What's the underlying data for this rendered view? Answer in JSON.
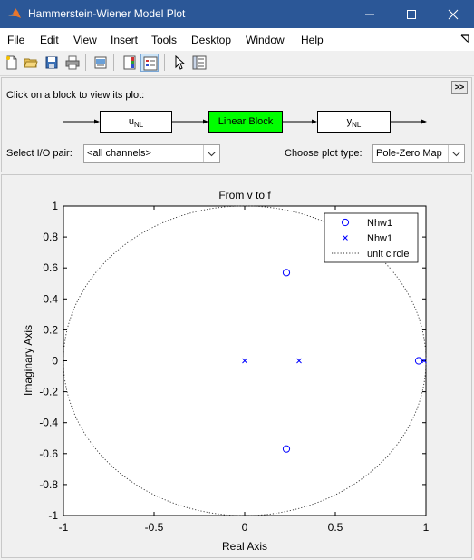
{
  "window": {
    "title": "Hammerstein-Wiener Model Plot"
  },
  "menu": [
    "File",
    "Edit",
    "View",
    "Insert",
    "Tools",
    "Desktop",
    "Window",
    "Help"
  ],
  "toolbar": {
    "icons": [
      "new-file-icon",
      "open-folder-icon",
      "save-icon",
      "print-icon",
      "print-preview-icon",
      "colorbar-icon",
      "legend-icon",
      "pointer-icon",
      "property-inspector-icon"
    ]
  },
  "panel": {
    "instruction": "Click on a block to view its plot:",
    "expand_label": ">>",
    "blocks": {
      "input": {
        "main": "u",
        "sub": "NL"
      },
      "linear": "Linear Block",
      "output": {
        "main": "y",
        "sub": "NL"
      }
    },
    "io_label": "Select I/O pair:",
    "io_value": "<all channels>",
    "plot_type_label": "Choose plot type:",
    "plot_type_value": "Pole-Zero Map"
  },
  "colors": {
    "titlebar": "#2b5797",
    "linear_block": "#00ff00",
    "marker": "#0000ff"
  },
  "chart_data": {
    "type": "scatter",
    "title": "From v to f",
    "xlabel": "Real Axis",
    "ylabel": "Imaginary Axis",
    "xlim": [
      -1,
      1
    ],
    "ylim": [
      -1,
      1
    ],
    "x_ticks": [
      "-1",
      "-0.5",
      "0",
      "0.5",
      "1"
    ],
    "y_ticks": [
      "1",
      "0.8",
      "0.6",
      "0.4",
      "0.2",
      "0",
      "-0.2",
      "-0.4",
      "-0.6",
      "-0.8",
      "-1"
    ],
    "grid": false,
    "legend_position": "top-right",
    "series": [
      {
        "name": "Nhw1",
        "marker": "o",
        "color": "#0000ff",
        "points": [
          [
            0.23,
            0.57
          ],
          [
            0.23,
            -0.57
          ],
          [
            0.96,
            0.0
          ]
        ]
      },
      {
        "name": "Nhw1",
        "marker": "x",
        "color": "#0000ff",
        "points": [
          [
            0.0,
            0.0
          ],
          [
            0.3,
            0.0
          ],
          [
            0.99,
            0.0
          ]
        ]
      }
    ],
    "reference": {
      "name": "unit circle",
      "style": "dotted"
    }
  }
}
